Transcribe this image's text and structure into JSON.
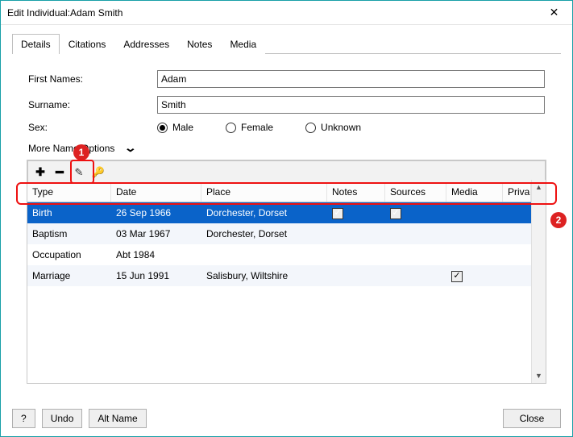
{
  "window": {
    "title": "Edit Individual:Adam Smith"
  },
  "tabs": [
    "Details",
    "Citations",
    "Addresses",
    "Notes",
    "Media"
  ],
  "active_tab": 0,
  "form": {
    "first_names_label": "First Names:",
    "first_names_value": "Adam",
    "surname_label": "Surname:",
    "surname_value": "Smith",
    "sex_label": "Sex:",
    "sex_options": [
      "Male",
      "Female",
      "Unknown"
    ],
    "sex_selected": 0,
    "more_options_label": "More Name Options"
  },
  "toolbar": {
    "add": "+",
    "delete": "−",
    "edit": "✎",
    "key": "🔑"
  },
  "table": {
    "columns": [
      "Type",
      "Date",
      "Place",
      "Notes",
      "Sources",
      "Media",
      "Privacy"
    ],
    "rows": [
      {
        "type": "Birth",
        "date": "26 Sep 1966",
        "place": "Dorchester, Dorset",
        "notes": true,
        "sources": true,
        "media": false,
        "privacy": false,
        "selected": true
      },
      {
        "type": "Baptism",
        "date": "03 Mar 1967",
        "place": "Dorchester, Dorset",
        "notes": false,
        "sources": false,
        "media": false,
        "privacy": false,
        "selected": false
      },
      {
        "type": "Occupation",
        "date": "Abt 1984",
        "place": "",
        "notes": false,
        "sources": false,
        "media": false,
        "privacy": false,
        "selected": false
      },
      {
        "type": "Marriage",
        "date": "15 Jun 1991",
        "place": "Salisbury, Wiltshire",
        "notes": false,
        "sources": false,
        "media": true,
        "privacy": false,
        "selected": false
      }
    ]
  },
  "footer": {
    "help": "?",
    "undo": "Undo",
    "alt_name": "Alt Name",
    "close": "Close"
  },
  "callouts": {
    "one": "1",
    "two": "2"
  }
}
